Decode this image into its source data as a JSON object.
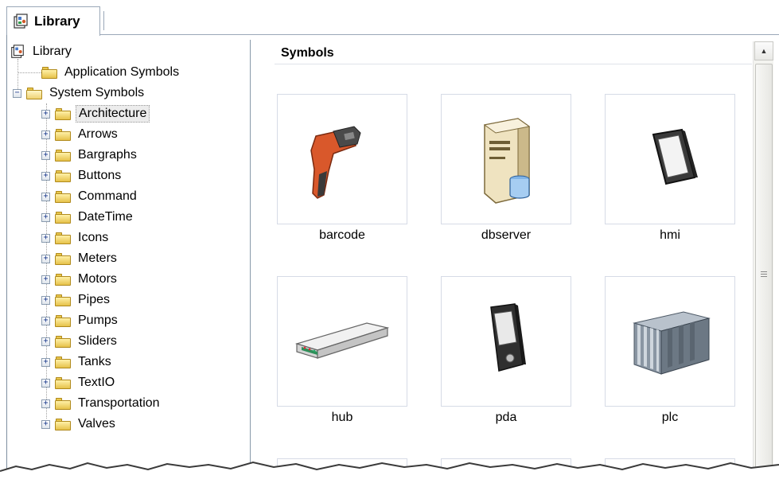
{
  "tab": {
    "label": "Library"
  },
  "tree": {
    "root": "Library",
    "application_symbols": "Application Symbols",
    "system_symbols": "System Symbols",
    "children": [
      "Architecture",
      "Arrows",
      "Bargraphs",
      "Buttons",
      "Command",
      "DateTime",
      "Icons",
      "Meters",
      "Motors",
      "Pipes",
      "Pumps",
      "Sliders",
      "Tanks",
      "TextIO",
      "Transportation",
      "Valves"
    ],
    "selected": "Architecture",
    "expander_closed": "+",
    "expander_open": "−"
  },
  "symbols": {
    "header": "Symbols",
    "items": [
      {
        "label": "barcode",
        "icon": "barcode-scanner-icon"
      },
      {
        "label": "dbserver",
        "icon": "database-server-icon"
      },
      {
        "label": "hmi",
        "icon": "hmi-panel-icon"
      },
      {
        "label": "hub",
        "icon": "network-hub-icon"
      },
      {
        "label": "pda",
        "icon": "pda-device-icon"
      },
      {
        "label": "plc",
        "icon": "plc-rack-icon"
      }
    ]
  },
  "scrollbar": {
    "up_glyph": "▲",
    "grip": "≡"
  },
  "colors": {
    "border": "#9aa8b8",
    "folder": "#e6c24a",
    "tile_border": "#d6dbe6"
  }
}
